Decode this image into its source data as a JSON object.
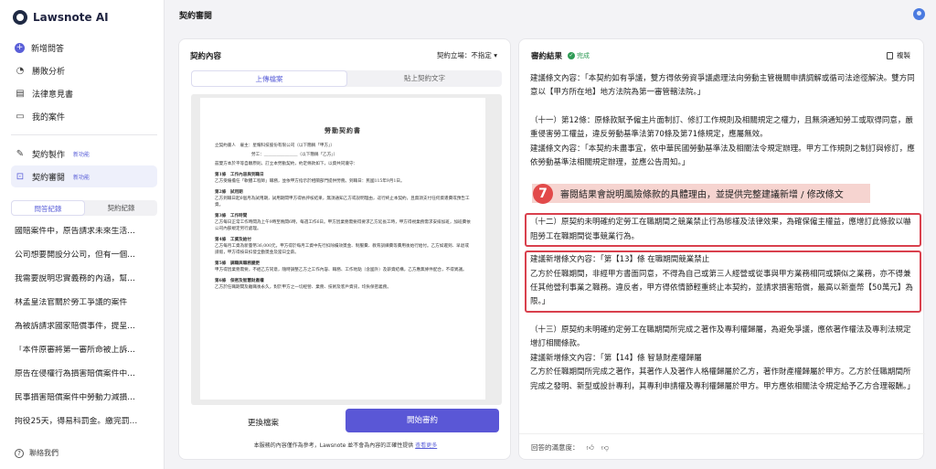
{
  "app": {
    "name": "Lawsnote AI"
  },
  "sidebar": {
    "top_items": [
      {
        "label": "新增問答",
        "icon": "plus-circle-icon"
      },
      {
        "label": "勝敗分析",
        "icon": "chart-icon"
      },
      {
        "label": "法律意見書",
        "icon": "document-icon"
      },
      {
        "label": "我的案件",
        "icon": "folder-icon"
      }
    ],
    "feature_items": [
      {
        "label": "契約製作",
        "badge": "新功能",
        "icon": "pen-icon"
      },
      {
        "label": "契約審閱",
        "badge": "新功能",
        "icon": "review-icon"
      }
    ],
    "tabs": [
      "問答紀錄",
      "契約紀錄"
    ],
    "history": [
      "國賠案件中，原告請求未來生活…",
      "公司想要開設分公司，但有一個…",
      "我需要說明忠實義務的內涵，幫…",
      "林孟皇法官關於勞工爭議的案件",
      "為被訴請求國家賠償事件，提呈…",
      "「本件原審將第一審所命被上訴…",
      "原告在侵權行為損害賠償案件中…",
      "民事損害賠償案件中勞動力減損…",
      "拘役25天，得易科罰金。繳完罰…"
    ],
    "contact": "聯絡我們"
  },
  "header": {
    "title": "契約審閱"
  },
  "left_panel": {
    "title": "契約內容",
    "stance": "契約立場：不指定",
    "tabs": [
      "上傳檔案",
      "貼上契約文字"
    ],
    "document": {
      "title": "勞動契約書",
      "parties": [
        "立契約書人　雇主：星耀科技股份有限公司（以下簡稱「甲方」）",
        "勞工：＿＿＿＿＿＿＿＿（以下簡稱「乙方」）",
        "茲雙方本於平等自願原則，訂立本勞動契約，約定條款如下，以資共同遵守："
      ],
      "articles": [
        {
          "title": "第1條　工作內容與到職日",
          "body": "乙方受僱擔任「軟體工程師」職務，並依甲方指示於相關部門提供勞務。到職日：民國115年9月1日。"
        },
        {
          "title": "第2條　試用期",
          "body": "乙方到職日起6個月為試用期，試用期間甲方得依評核結果，無須通知乙方或說明理由，逕行終止本契約，且無須支付任何資遣費或預告工資。"
        },
        {
          "title": "第3條　工作時間",
          "body": "乙方每日正常工作時間為上午9時至晚間6時，每週工作6日。甲方因業務需要得要求乙方延長工時，甲方得視業務需求安排加班，加班費依公司內部規定另行處理。"
        },
        {
          "title": "第4條　工資及給付",
          "body": "乙方每月工資為新臺幣36,000元，甲方得於每月工資中先行扣除績效獎金、制服費、教育訓練費等費用後始行給付。乙方如遲到、早退或請假，甲方得按日扣發全勤獎金及當日全薪。"
        },
        {
          "title": "第5條　調職與職務變更",
          "body": "甲方得因業務需要，不經乙方同意，隨時調整乙方之工作內容、職務、工作地點（含國外）及薪資結構，乙方應無條件配合，不得異議。"
        },
        {
          "title": "第6條　保密及智慧財產權",
          "body": "乙方於任職期間及離職後永久，對於甲方之一切經營、業務、技術及客戶資訊，均負保密義務。"
        }
      ]
    },
    "change_button": "更換檔案",
    "start_button": "開始審約",
    "disclaimer": "本服務的內容僅作為參考，Lawsnote 並不會為內容的正確性提供",
    "disclaimer_link": "查看更多"
  },
  "right_panel": {
    "title": "審約結果",
    "status": "完成",
    "copy_label": "複製",
    "block0": "建議條文內容：「本契約如有爭議，雙方得依勞資爭議處理法向勞動主管機關申請調解或循司法途徑解決。雙方同意以【甲方所在地】地方法院為第一審管轄法院。」",
    "block11a": "（十一）第12條：原條款賦予僱主片面制訂、修訂工作規則及相關規定之權力，且無須通知勞工或取得同意，嚴重侵害勞工權益，違反勞動基準法第70條及第71條規定，應屬無效。",
    "block11b": "建議條文內容：「本契約未盡事宜，依中華民國勞動基準法及相關法令規定辦理。甲方工作規則之制訂與修訂，應依勞動基準法相關規定辦理，並應公告周知。」",
    "block12a": "（十二）原契約未明確約定勞工在職期間之競業禁止行為態樣及法律效果，為確保僱主權益，應增訂此條款以嚇阻勞工在職期間從事競業行為。",
    "block12b_line1": "建議新增條文內容：「第【13】條 在職期間競業禁止",
    "block12b_line2": "乙方於任職期間，非經甲方書面同意，不得為自己或第三人經營或從事與甲方業務相同或類似之業務，亦不得兼任其他營利事業之職務。違反者，甲方得依情節輕重終止本契約，並請求損害賠償，最高以新臺幣【50萬元】為限。」",
    "block13a": "（十三）原契約未明確約定勞工在職期間所完成之著作及專利權歸屬，為避免爭議，應依著作權法及專利法規定增訂相關條款。",
    "block13b_line1": "建議新增條文內容：「第【14】條 智慧財產權歸屬",
    "block13b_line2": "乙方於任職期間所完成之著作，其著作人及著作人格權歸屬於乙方，著作財產權歸屬於甲方。乙方於任職期間所完成之發明、新型或設計專利，其專利申請權及專利權歸屬於甲方。甲方應依相關法令規定給予乙方合理報酬。」",
    "callout_number": "7",
    "callout_text": "審閱結果會說明風險條款的具體理由，並提供完整建議新增 / 修改條文",
    "feedback_label": "回答的滿意度："
  }
}
